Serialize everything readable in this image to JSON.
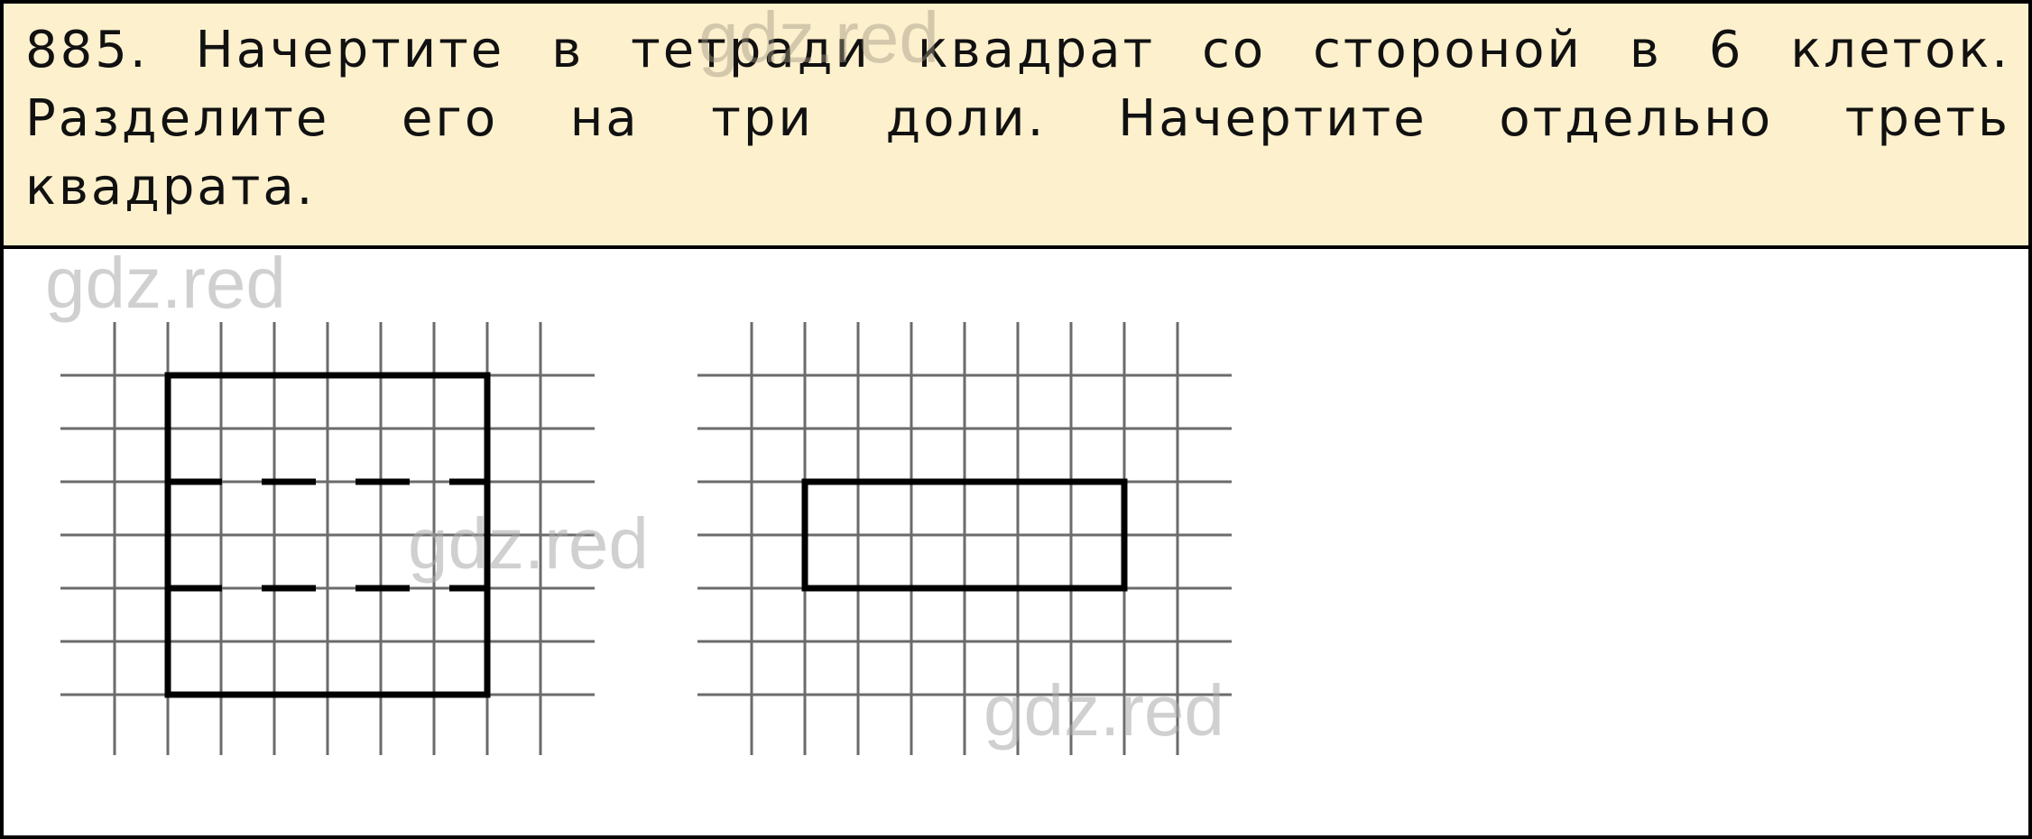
{
  "task": {
    "number": "885.",
    "text": "Начертите в тетради квадрат со стороной в 6 клеток. Разделите его на три доли. Начертите отдельно треть квадрата."
  },
  "watermarks": [
    "gdz.red",
    "gdz.red",
    "gdz.red",
    "gdz.red"
  ],
  "figures": {
    "left_grid": {
      "description": "Square 6×6 cells divided into three equal parts by two dashed lines",
      "columns": 8,
      "rows": 8,
      "square_cells": {
        "col": 1,
        "row": 1,
        "width": 6,
        "height": 6
      },
      "dashed_divider_rows": [
        3,
        5
      ]
    },
    "right_grid": {
      "description": "One third of the square: rectangle 6×2 cells",
      "columns": 8,
      "rows": 8,
      "rectangle_cells": {
        "col": 1,
        "row": 3,
        "width": 6,
        "height": 2
      }
    }
  },
  "colors": {
    "header_bg": "#fdf0cd",
    "grid_line": "#6b6b6b",
    "figure_line": "#000000",
    "watermark": "#c8c8c8"
  }
}
